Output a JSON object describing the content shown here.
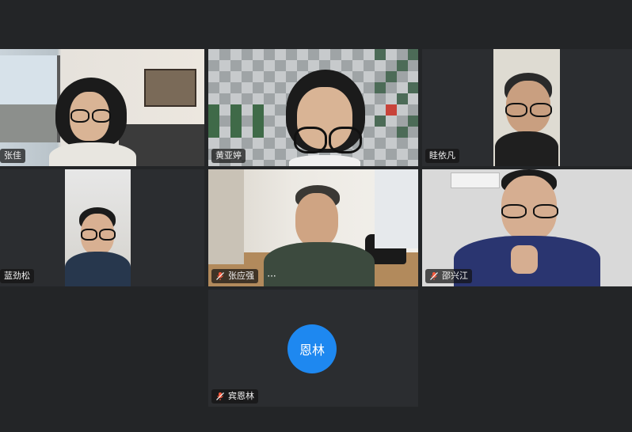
{
  "participants": [
    {
      "name": "张佳",
      "muted": false
    },
    {
      "name": "黄亚婷",
      "muted": false
    },
    {
      "name": "眭依凡",
      "muted": false
    },
    {
      "name": "蓝劲松",
      "muted": false
    },
    {
      "name": "张应强",
      "muted": true
    },
    {
      "name": "邵兴江",
      "muted": true
    },
    {
      "name": "宾恩林",
      "muted": true,
      "avatar_text": "恩林"
    }
  ],
  "colors": {
    "background": "#232527",
    "tile": "#2b2d30",
    "avatar": "#1e88f0",
    "muted_mic": "#ff5a3c"
  },
  "more_menu": "···"
}
